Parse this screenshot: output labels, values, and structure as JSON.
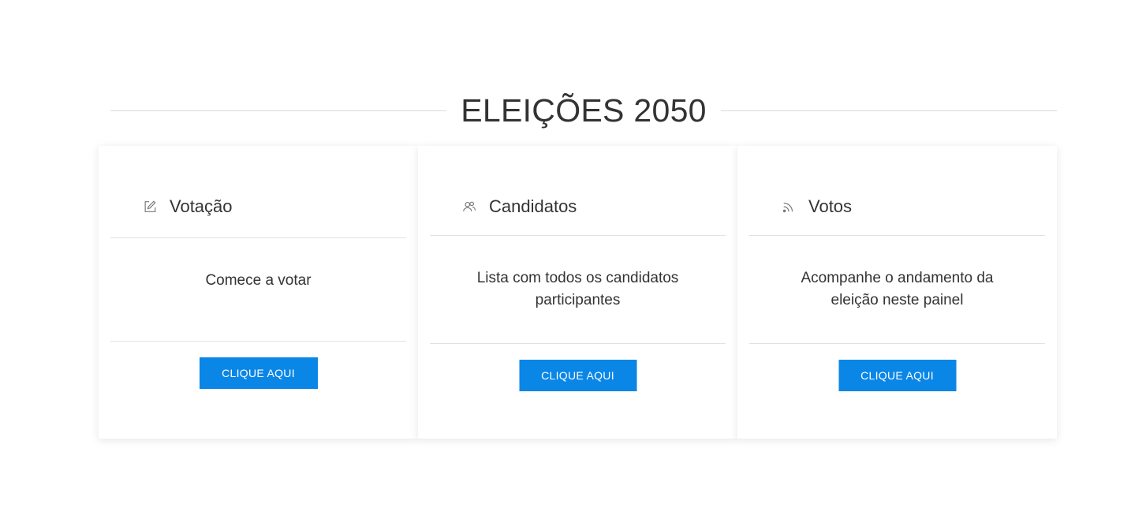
{
  "page": {
    "title": "ELEIÇÕES 2050"
  },
  "cards": [
    {
      "icon": "edit-icon",
      "title": "Votação",
      "description": "Comece a votar",
      "button_label": "CLIQUE AQUI"
    },
    {
      "icon": "users-icon",
      "title": "Candidatos",
      "description": "Lista com todos os candidatos participantes",
      "button_label": "CLIQUE AQUI"
    },
    {
      "icon": "rss-icon",
      "title": "Votos",
      "description": "Acompanhe o andamento da eleição neste painel",
      "button_label": "CLIQUE AQUI"
    }
  ],
  "colors": {
    "button": "#0a86e6",
    "text": "#333333",
    "divider": "#e2e2e2"
  }
}
